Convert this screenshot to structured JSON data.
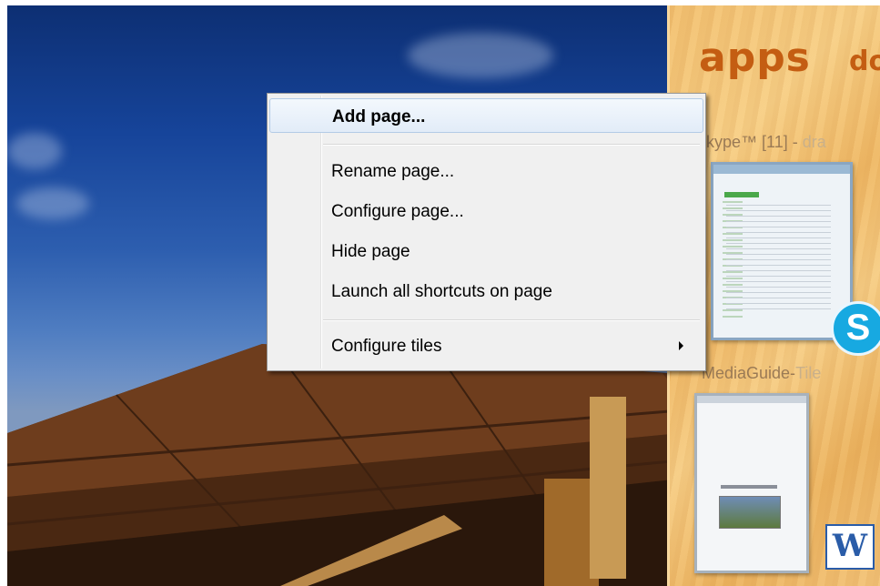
{
  "panel": {
    "title": "apps",
    "title_cut": "do",
    "tiles": [
      {
        "label": "kype™ [11] - ",
        "label_dim": "dra",
        "icon": "skype-icon"
      },
      {
        "label": "MediaGuide-",
        "label_dim": "Tile",
        "icon": "word-icon"
      }
    ]
  },
  "icons": {
    "skype_glyph": "S",
    "word_glyph": "W"
  },
  "menu": {
    "items": [
      {
        "label": "Add page...",
        "bold": true,
        "highlighted": true
      },
      {
        "label": "Rename page..."
      },
      {
        "label": "Configure page..."
      },
      {
        "label": "Hide page"
      },
      {
        "label": "Launch all shortcuts on page"
      },
      {
        "label": "Configure tiles",
        "submenu": true
      }
    ]
  },
  "colors": {
    "accent_text": "#c45d12",
    "menu_bg": "#f0f0f0",
    "highlight_border": "#b3cbe6"
  }
}
